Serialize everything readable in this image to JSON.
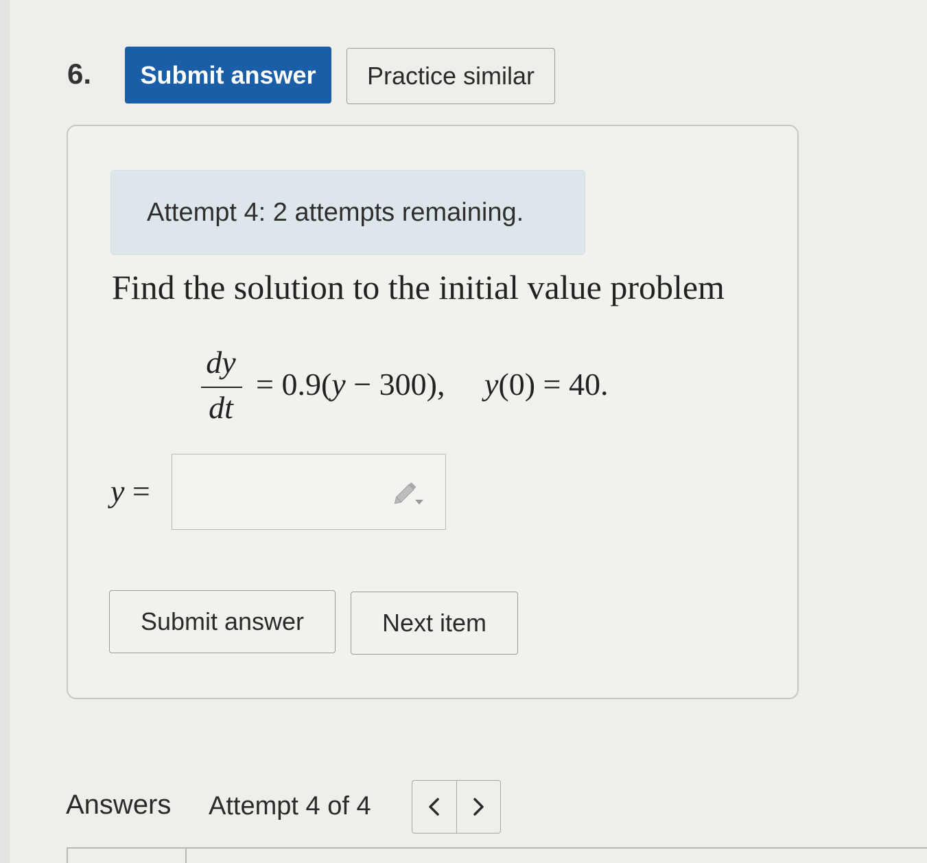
{
  "question": {
    "number": "6."
  },
  "header": {
    "submit_label": "Submit answer",
    "practice_label": "Practice similar"
  },
  "card": {
    "attempt_notice": "Attempt 4: 2 attempts remaining.",
    "prompt": "Find the solution to the initial value problem",
    "equation": {
      "numerator": "dy",
      "denominator": "dt",
      "rhs_equals": "=",
      "rhs_coef": "0.9(",
      "rhs_var": "y",
      "rhs_tail": " − 300),",
      "ic_var": "y",
      "ic_tail": "(0) = 40."
    },
    "answer_label_var": "y",
    "answer_label_eq": " =",
    "answer_value": "",
    "submit_label": "Submit answer",
    "next_label": "Next item"
  },
  "footer": {
    "answers_label": "Answers",
    "attempt_text": "Attempt 4 of 4"
  },
  "icons": {
    "pencil": "pencil-dropdown-icon",
    "prev": "chevron-left-icon",
    "next": "chevron-right-icon"
  },
  "colors": {
    "primary": "#1b5ea8",
    "notice_bg": "#dde6ea"
  }
}
